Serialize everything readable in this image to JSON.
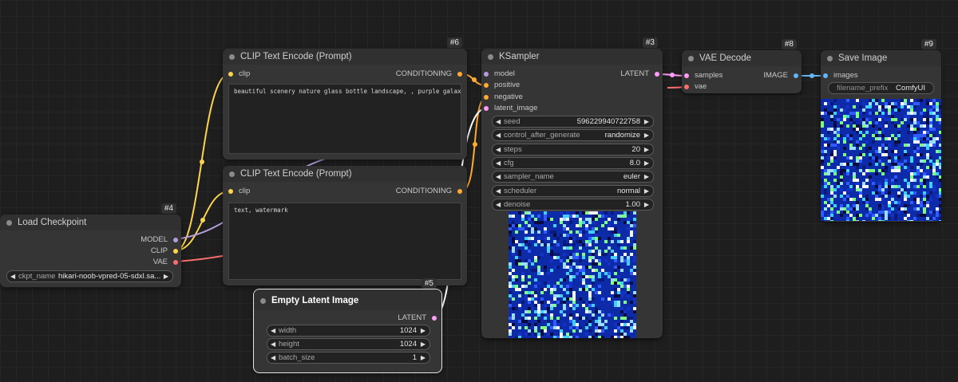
{
  "colors": {
    "clip": "#fcd34d",
    "model": "#b39ddb",
    "conditioning": "#ffa931",
    "latent": "#ff9cf9",
    "vae": "#ff6e6e",
    "image": "#64b5f6",
    "background": "#1e1e1e",
    "node": "#353535"
  },
  "nodes": {
    "load_checkpoint": {
      "id": "#4",
      "title": "Load Checkpoint",
      "outputs": [
        "MODEL",
        "CLIP",
        "VAE"
      ],
      "widget": {
        "name": "ckpt_name",
        "value": "hikari-noob-vpred-05-sdxl.sa..."
      }
    },
    "clip_pos": {
      "id": "#6",
      "title": "CLIP Text Encode (Prompt)",
      "input": "clip",
      "output": "CONDITIONING",
      "text": "beautiful scenery nature glass bottle landscape, , purple galaxy bottle,"
    },
    "clip_neg": {
      "title": "CLIP Text Encode (Prompt)",
      "input": "clip",
      "output": "CONDITIONING",
      "text": "text, watermark"
    },
    "empty_latent": {
      "id": "#5",
      "title": "Empty Latent Image",
      "output": "LATENT",
      "widgets": [
        {
          "name": "width",
          "value": "1024"
        },
        {
          "name": "height",
          "value": "1024"
        },
        {
          "name": "batch_size",
          "value": "1"
        }
      ]
    },
    "ksampler": {
      "id": "#3",
      "title": "KSampler",
      "inputs": [
        "model",
        "positive",
        "negative",
        "latent_image"
      ],
      "output": "LATENT",
      "widgets": [
        {
          "name": "seed",
          "value": "596229940722758"
        },
        {
          "name": "control_after_generate",
          "value": "randomize"
        },
        {
          "name": "steps",
          "value": "20"
        },
        {
          "name": "cfg",
          "value": "8.0"
        },
        {
          "name": "sampler_name",
          "value": "euler"
        },
        {
          "name": "scheduler",
          "value": "normal"
        },
        {
          "name": "denoise",
          "value": "1.00"
        }
      ]
    },
    "vae_decode": {
      "id": "#8",
      "title": "VAE Decode",
      "inputs": [
        "samples",
        "vae"
      ],
      "output": "IMAGE"
    },
    "save_image": {
      "id": "#9",
      "title": "Save Image",
      "input": "images",
      "widget": {
        "name": "filename_prefix",
        "value": "ComfyUI"
      }
    }
  }
}
